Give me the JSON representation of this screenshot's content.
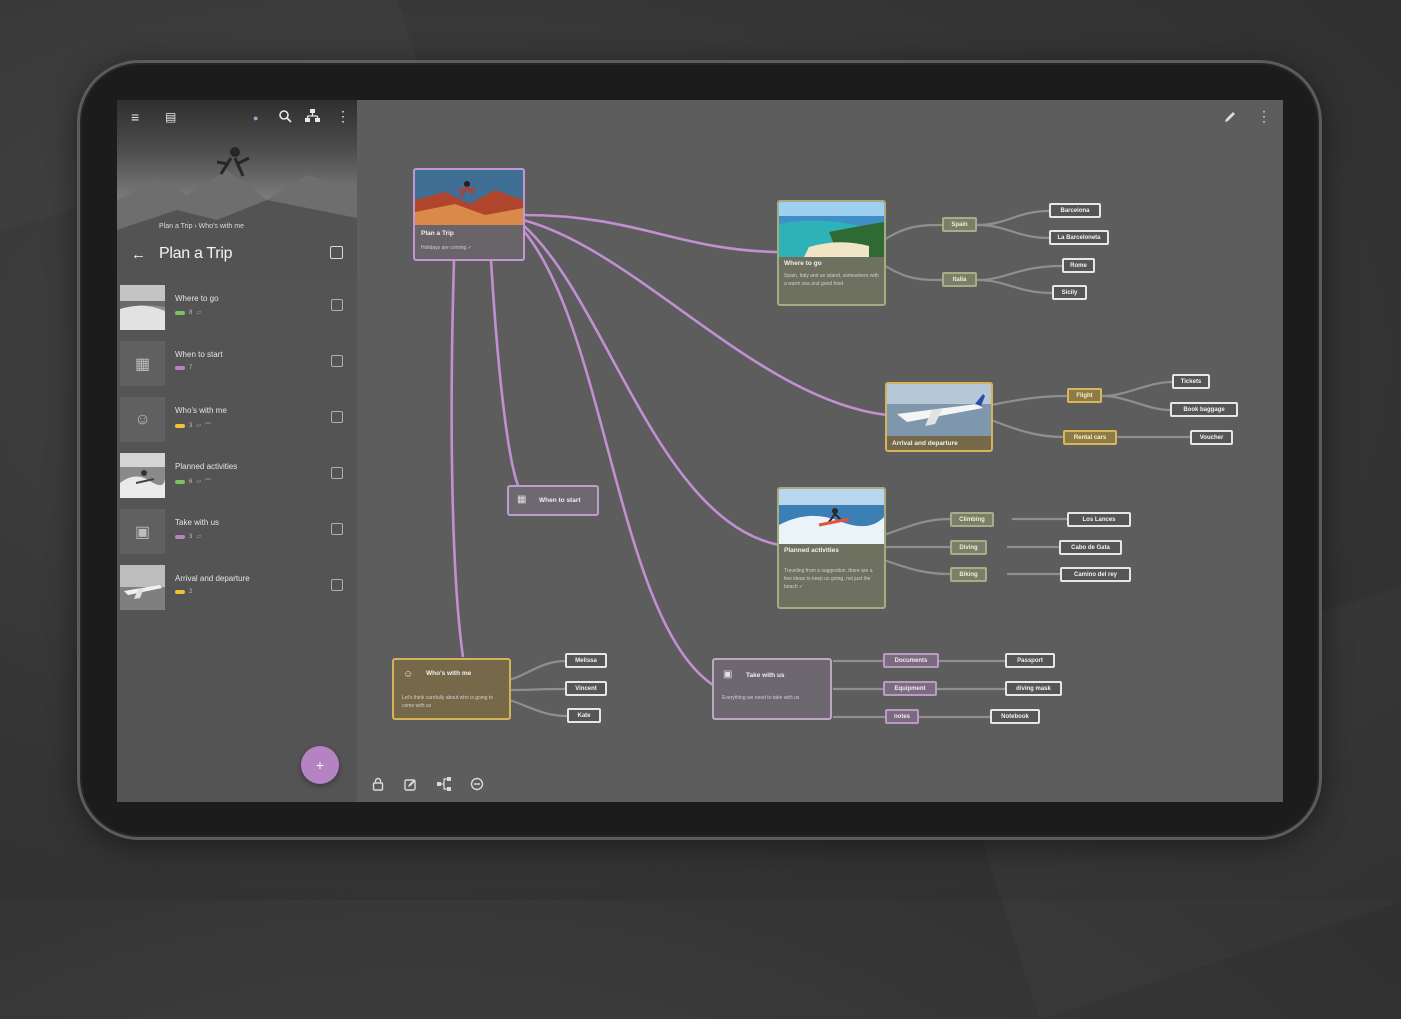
{
  "app": {
    "toolbar_icons": [
      "menu-icon",
      "view-icon",
      "dot-icon",
      "search-icon",
      "hierarchy-icon",
      "more-icon"
    ],
    "canvas_icons": [
      "pencil-icon",
      "more-icon"
    ],
    "accent": "#b583c4"
  },
  "sidebar": {
    "breadcrumb": "Plan a Trip › Who's with me",
    "title": "Plan a Trip",
    "items": [
      {
        "title": "Where to go",
        "count": "8",
        "tag": "#7dc35e"
      },
      {
        "title": "When to start",
        "count": "7",
        "tag": "#b583c4"
      },
      {
        "title": "Who's with me",
        "count": "3",
        "tag": "#f2c230"
      },
      {
        "title": "Planned activities",
        "count": "6",
        "tag": "#7dc35e"
      },
      {
        "title": "Take with us",
        "count": "3",
        "tag": "#b583c4"
      },
      {
        "title": "Arrival and departure",
        "count": "2",
        "tag": "#f2c230"
      }
    ],
    "fab_label": "+"
  },
  "canvas": {
    "root": {
      "title": "Plan a Trip",
      "desc": "Holidays are coming ✓"
    },
    "where_to_go": {
      "title": "Where to go",
      "desc": "Spain, Italy and an island, somewhere with a warm sea and good food",
      "branches": [
        {
          "label": "Spain",
          "children": [
            "Barcelona",
            "La Barceloneta"
          ]
        },
        {
          "label": "Italia",
          "children": [
            "Rome",
            "Sicily"
          ]
        }
      ]
    },
    "arrival": {
      "title": "Arrival and departure",
      "branches": [
        {
          "label": "Flight",
          "children": [
            "Tickets",
            "Book baggage"
          ]
        },
        {
          "label": "Rental cars",
          "children": [
            "Voucher"
          ]
        }
      ]
    },
    "when_to_start": {
      "title": "When to start"
    },
    "activities": {
      "title": "Planned activities",
      "desc": "Traveling from a suggestion, there are a few ideas to keep us going, not just the beach ✓",
      "branches": [
        {
          "label": "Climbing",
          "child": "Los Lances"
        },
        {
          "label": "Diving",
          "child": "Cabo de Gata"
        },
        {
          "label": "Biking",
          "child": "Camino del rey"
        }
      ]
    },
    "whos_with_me": {
      "title": "Who's with me",
      "desc": "Let's think carefully about who is going to come with us",
      "children": [
        "Melissa",
        "Vincent",
        "Kate"
      ]
    },
    "take_with_us": {
      "title": "Take with us",
      "desc": "Everything we need to take with us",
      "branches": [
        {
          "label": "Documents",
          "child": "Passport"
        },
        {
          "label": "Equipment",
          "child": "diving mask"
        },
        {
          "label": "notes",
          "child": "Notebook"
        }
      ]
    },
    "bottom_icons": [
      "lock-icon",
      "edit-icon",
      "branch-icon",
      "zoom-out-icon"
    ]
  }
}
